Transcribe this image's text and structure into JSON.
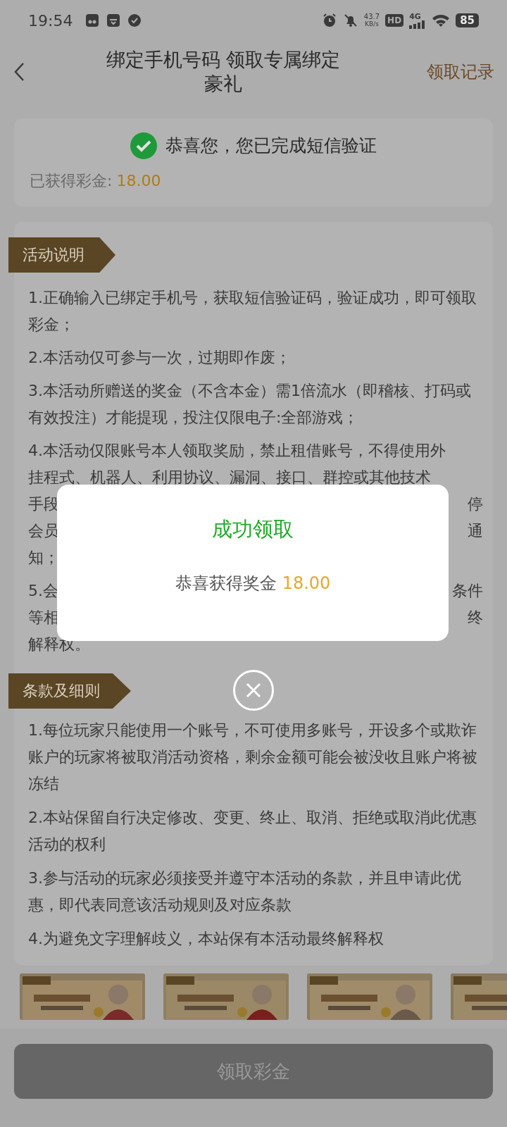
{
  "status_bar": {
    "time": "19:54",
    "speed": "43.7",
    "speed_unit": "KB/s",
    "hd": "HD",
    "network": "4G",
    "battery": "85"
  },
  "header": {
    "title": "绑定手机号码 领取专属绑定豪礼",
    "action": "领取记录"
  },
  "verify_card": {
    "message": "恭喜您，您已完成短信验证",
    "reward_label": "已获得彩金:",
    "reward_value": "18.00"
  },
  "activity": {
    "heading": "活动说明",
    "items": [
      {
        "kind": "paragraph",
        "text": "1.正确输入已绑定手机号，获取短信验证码，验证成功，即可领取彩金；"
      },
      {
        "kind": "paragraph",
        "text": "2.本活动仅可参与一次，过期即作废；"
      },
      {
        "kind": "paragraph",
        "text": "3.本活动所赠送的奖金（不含本金）需1倍流水（即稽核、打码或有效投注）才能提现，投注仅限电子:全部游戏；"
      },
      {
        "kind": "partial",
        "lines": [
          {
            "left": "4.本活动仅限账号本人领取奖励，禁止租借账号，不得使用外"
          },
          {
            "left": "挂程式、机器人、利用协议、漏洞、接口、群控或其他技术"
          },
          {
            "left": "手段",
            "right": "停"
          },
          {
            "left": "会员",
            "right": "通"
          },
          {
            "left": "知；"
          }
        ]
      },
      {
        "kind": "partial",
        "lines": [
          {
            "left": "5.会",
            "right": "条件"
          },
          {
            "left": "等相",
            "right": "终"
          },
          {
            "left": "解释权。"
          }
        ]
      }
    ]
  },
  "terms": {
    "heading": "条款及细则",
    "items": [
      "1.每位玩家只能使用一个账号，不可使用多账号，开设多个或欺诈账户的玩家将被取消活动资格，剩余金额可能会被没收且账户将被冻结",
      "2.本站保留自行决定修改、变更、终止、取消、拒绝或取消此优惠活动的权利",
      "3.参与活动的玩家必须接受并遵守本活动的条款，并且申请此优惠，即代表同意该活动规则及对应条款",
      "4.为避免文字理解歧义，本站保有本活动最终解释权"
    ]
  },
  "claim_button": {
    "label": "领取彩金",
    "disabled": true
  },
  "modal": {
    "title": "成功领取",
    "message": "恭喜获得奖金",
    "amount": "18.00"
  }
}
